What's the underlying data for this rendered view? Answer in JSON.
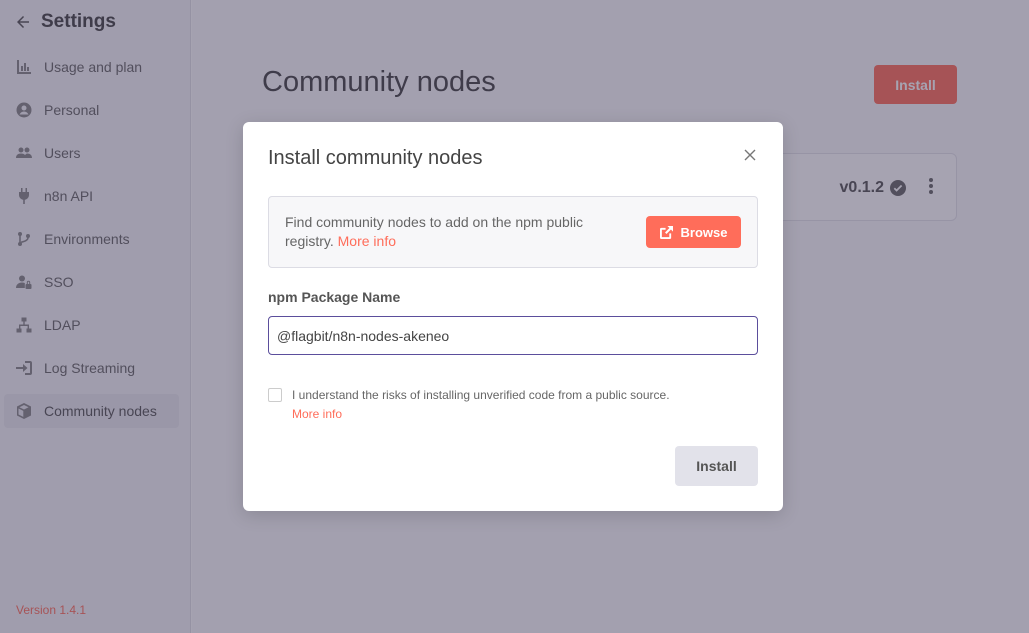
{
  "sidebar": {
    "title": "Settings",
    "items": [
      {
        "label": "Usage and plan",
        "icon": "chart-icon"
      },
      {
        "label": "Personal",
        "icon": "user-circle-icon"
      },
      {
        "label": "Users",
        "icon": "users-icon"
      },
      {
        "label": "n8n API",
        "icon": "plug-icon"
      },
      {
        "label": "Environments",
        "icon": "branch-icon"
      },
      {
        "label": "SSO",
        "icon": "user-lock-icon"
      },
      {
        "label": "LDAP",
        "icon": "network-icon"
      },
      {
        "label": "Log Streaming",
        "icon": "sign-in-icon"
      },
      {
        "label": "Community nodes",
        "icon": "cube-icon",
        "active": true
      }
    ],
    "version": "Version 1.4.1"
  },
  "main": {
    "title": "Community nodes",
    "install_label": "Install",
    "package": {
      "version": "v0.1.2"
    }
  },
  "modal": {
    "title": "Install community nodes",
    "info_text": "Find community nodes to add on the npm public registry.",
    "info_link": "More info",
    "browse_label": "Browse",
    "field_label": "npm Package Name",
    "package_value": "@flagbit/n8n-nodes-akeneo",
    "risk_text": "I understand the risks of installing unverified code from a public source.",
    "risk_link": "More info",
    "install_label": "Install"
  },
  "colors": {
    "accent": "#ff6d5a",
    "overlay": "#3a3452",
    "input_focus": "#5b4e9c"
  }
}
